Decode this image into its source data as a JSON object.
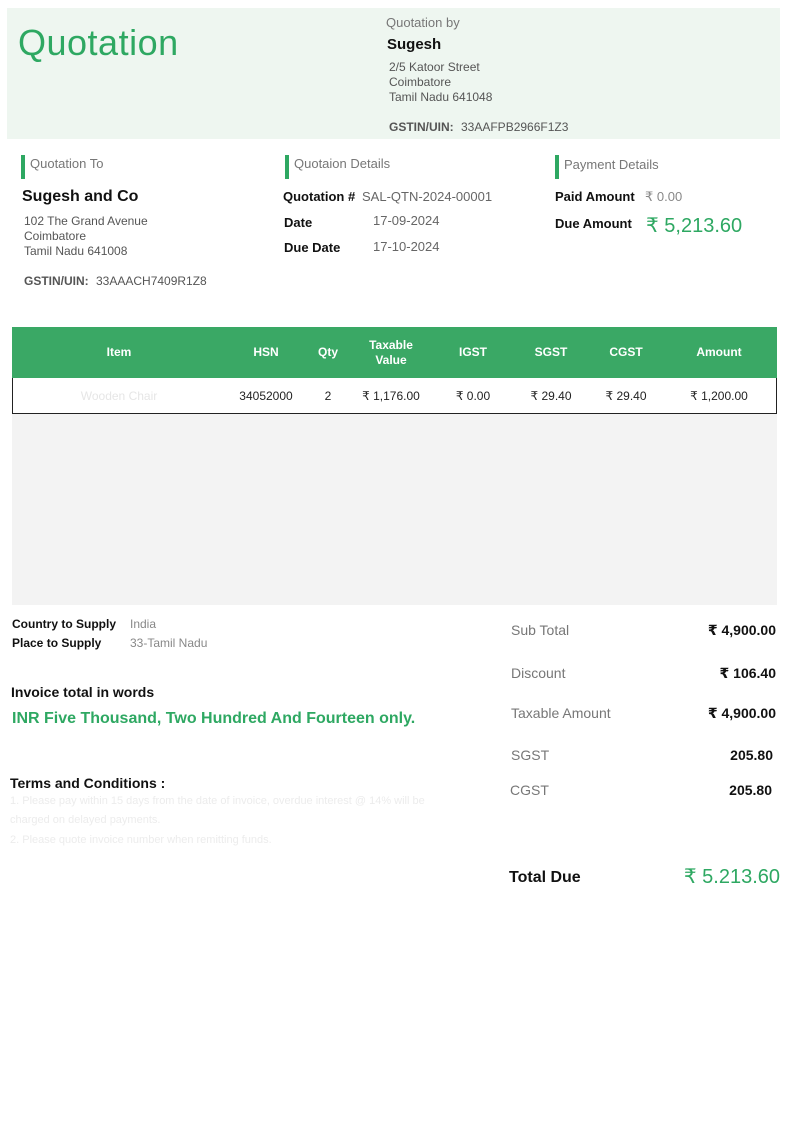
{
  "title": "Quotation",
  "quotation_by": {
    "heading": "Quotation by",
    "name": "Sugesh",
    "address_line1": "2/5 Katoor Street",
    "address_line2": "Coimbatore",
    "address_line3": "Tamil Nadu 641048",
    "gstin_label": "GSTIN/UIN:",
    "gstin_value": "33AAFPB2966F1Z3"
  },
  "quotation_to": {
    "heading": "Quotation To",
    "name": "Sugesh and Co",
    "address_line1": "102 The Grand Avenue",
    "address_line2": "Coimbatore",
    "address_line3": "Tamil Nadu 641008",
    "gstin_label": "GSTIN/UIN:",
    "gstin_value": "33AAACH7409R1Z8"
  },
  "quotation_details": {
    "heading": "Quotaion Details",
    "number_label": "Quotation #",
    "number_value": "SAL-QTN-2024-00001",
    "date_label": "Date",
    "date_value": "17-09-2024",
    "due_label": "Due Date",
    "due_value": "17-10-2024"
  },
  "payment_details": {
    "heading": "Payment Details",
    "paid_label": "Paid Amount",
    "paid_value": "₹ 0.00",
    "due_label": "Due Amount",
    "due_value": "₹ 5,213.60"
  },
  "table": {
    "headers": [
      "Item",
      "HSN",
      "Qty",
      "Taxable Value",
      "IGST",
      "SGST",
      "CGST",
      "Amount"
    ],
    "rows": [
      [
        "Wooden Chair",
        "34052000",
        "2",
        "₹ 1,176.00",
        "₹ 0.00",
        "₹ 29.40",
        "₹ 29.40",
        "₹ 1,200.00"
      ]
    ]
  },
  "supply": {
    "country_label": "Country to Supply",
    "country_value": "India",
    "place_label": "Place to Supply",
    "place_value": "33-Tamil Nadu"
  },
  "words": {
    "heading": "Invoice total in words",
    "value": "INR Five Thousand, Two Hundred And Fourteen only."
  },
  "terms": {
    "heading": "Terms and Conditions :",
    "line1a": "1. Please pay within 15 days from the date of invoice, overdue interest @ 14% will be",
    "line1b": "charged on delayed payments.",
    "line2": "2. Please quote invoice number when remitting funds."
  },
  "totals": {
    "subtotal_label": "Sub Total",
    "subtotal_value": "₹ 4,900.00",
    "discount_label": "Discount",
    "discount_value": "₹ 106.40",
    "taxable_label": "Taxable Amount",
    "taxable_value": "₹ 4,900.00",
    "sgst_label": "SGST",
    "sgst_value": "205.80",
    "cgst_label": "CGST",
    "cgst_value": "205.80",
    "total_label": "Total Due",
    "total_value": "₹ 5.213.60"
  },
  "colors": {
    "accent": "#2ea862",
    "header_band": "#eef6f0",
    "table_header": "#3aa865"
  }
}
